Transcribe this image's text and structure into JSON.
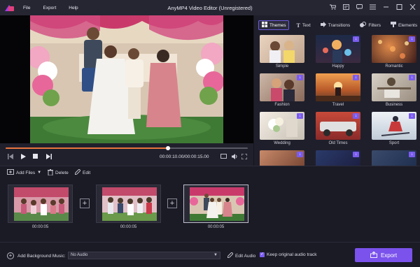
{
  "titlebar": {
    "menu": [
      "File",
      "Export",
      "Help"
    ],
    "title": "AnyMP4 Video Editor (Unregistered)"
  },
  "preview": {
    "time": "00:00:10.00/00:00:15.00",
    "progress_fraction": 0.67
  },
  "panel": {
    "tabs": [
      {
        "label": "Themes",
        "icon": "themes-icon",
        "active": true
      },
      {
        "label": "Text",
        "icon": "text-icon"
      },
      {
        "label": "Transitions",
        "icon": "transitions-icon"
      },
      {
        "label": "Filters",
        "icon": "filters-icon"
      },
      {
        "label": "Elements",
        "icon": "elements-icon"
      }
    ],
    "themes": [
      "Simple",
      "Happy",
      "Romantic",
      "Fashion",
      "Travel",
      "Business",
      "Wedding",
      "Old Times",
      "Sport"
    ]
  },
  "toolbar": {
    "add_files": "Add Files",
    "delete": "Delete",
    "edit": "Edit"
  },
  "timeline": {
    "clips": [
      {
        "time": "00:00:05"
      },
      {
        "time": "00:00:05"
      },
      {
        "time": "00:00:05",
        "selected": true
      }
    ]
  },
  "bottom": {
    "add_bg_music": "Add Background Music:",
    "audio_value": "No Audio",
    "edit_audio": "Edit Audio",
    "keep_audio": "Keep original audio track",
    "export": "Export"
  },
  "colors": {
    "accent": "#7b52ec",
    "progress": "#e8763e",
    "background": "#1b1b26"
  }
}
